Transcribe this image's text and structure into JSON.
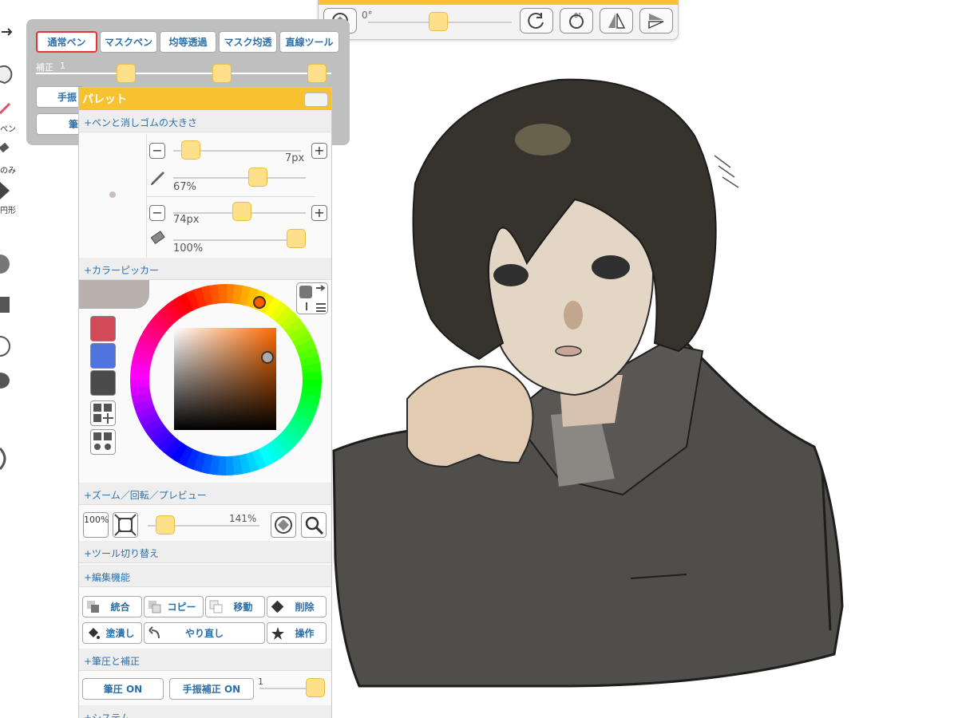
{
  "left_toolbar": {
    "labels": [
      "ペン",
      "のみ",
      "円形"
    ]
  },
  "rotation_bar": {
    "angle_label": "0°",
    "slider_value": 0.5
  },
  "pen_panel": {
    "tabs": [
      "通常ペン",
      "マスクペン",
      "均等透過",
      "マスク均透",
      "直線ツール"
    ],
    "selected_tab": "通常ペン",
    "correction_label": "補正",
    "correction_value": "1",
    "buttons": [
      "手振",
      "筆"
    ]
  },
  "palette": {
    "title": "パレット",
    "sections": {
      "pen_eraser_size": "+ペンと消しゴムの大きさ",
      "color_picker": "+カラーピッカー",
      "zoom": "+ズーム／回転／プレビュー",
      "tool_switch": "+ツール切り替え",
      "edit": "+編集機能",
      "pressure": "+筆圧と補正",
      "system": "+システム"
    },
    "pen_size": "7px",
    "pen_opacity": "67%",
    "eraser_size": "74px",
    "eraser_opacity": "100%",
    "swatches": [
      "#d24a57",
      "#4f74de",
      "#4a4a4a"
    ],
    "zoom_label": "100%",
    "zoom_value": "141%",
    "edit_buttons": [
      "統合",
      "コピー",
      "移動",
      "削除",
      "塗潰し",
      "やり直し",
      "操作"
    ],
    "pressure_buttons": [
      "筆圧 ON",
      "手振補正 ON"
    ],
    "pressure_value": "1"
  },
  "canvas": {
    "accent_text": "…"
  }
}
